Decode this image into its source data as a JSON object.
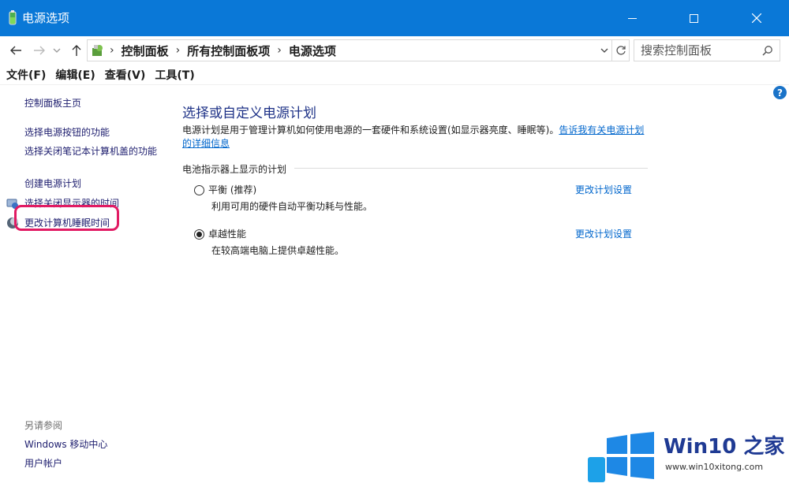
{
  "window": {
    "title": "电源选项",
    "buttons": {
      "minimize": "minimize",
      "maximize": "maximize",
      "close": "close"
    }
  },
  "address": {
    "breadcrumbs": [
      "控制面板",
      "所有控制面板项",
      "电源选项"
    ],
    "search_placeholder": "搜索控制面板"
  },
  "menu": [
    "文件(F)",
    "编辑(E)",
    "查看(V)",
    "工具(T)"
  ],
  "left_pane": {
    "links": [
      "控制面板主页",
      "选择电源按钮的功能",
      "选择关闭笔记本计算机盖的功能",
      "创建电源计划",
      "选择关闭显示器的时间",
      "更改计算机睡眠时间"
    ],
    "see_also_title": "另请参阅",
    "see_also_links": [
      "Windows 移动中心",
      "用户帐户"
    ]
  },
  "content": {
    "heading": "选择或自定义电源计划",
    "description": "电源计划是用于管理计算机如何使用电源的一套硬件和系统设置(如显示器亮度、睡眠等)。",
    "description_link": "告诉我有关电源计划的详细信息",
    "group_title": "电池指示器上显示的计划",
    "plans": [
      {
        "name": "平衡 (推荐)",
        "desc": "利用可用的硬件自动平衡功耗与性能。",
        "link": "更改计划设置",
        "selected": false
      },
      {
        "name": "卓越性能",
        "desc": "在较高端电脑上提供卓越性能。",
        "link": "更改计划设置",
        "selected": true
      }
    ]
  },
  "help_label": "?",
  "watermark": {
    "title": "Win10 之家",
    "url": "www.win10xitong.com"
  },
  "colors": {
    "titlebar": "#0a78d7",
    "link": "#0066cc",
    "heading": "#1e3287",
    "highlight": "#e11b63"
  }
}
